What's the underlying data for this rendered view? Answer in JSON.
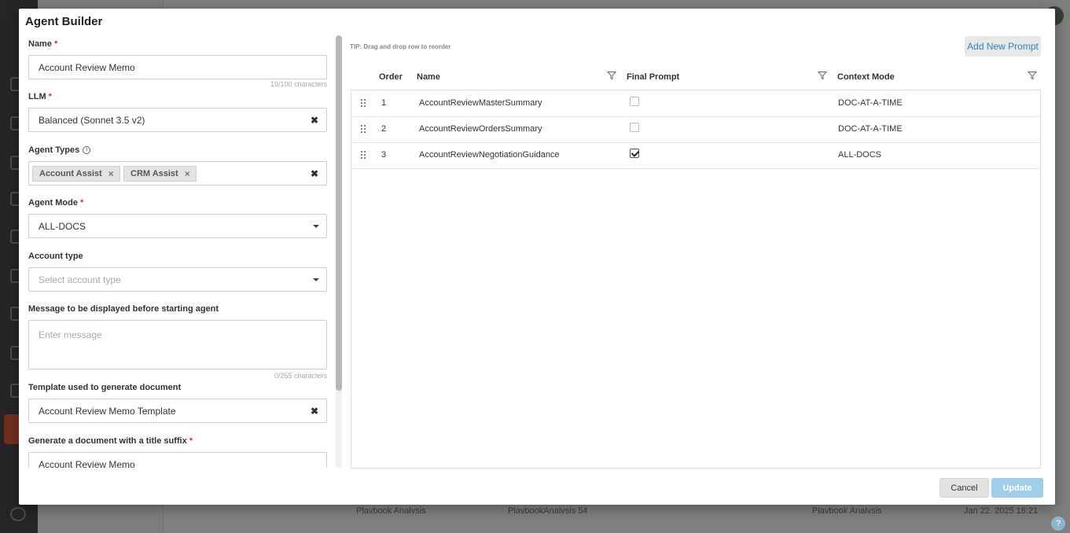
{
  "background": {
    "row": {
      "col1": "Plavbook Analvsis",
      "col2": "PlavbookAnalvsis 54",
      "col3": "Plavbook Analvsis",
      "col4": "Jan 22. 2025 16:21"
    },
    "help": "?"
  },
  "modal": {
    "title": "Agent Builder",
    "form": {
      "name": {
        "label": "Name",
        "value": "Account Review Memo",
        "counter": "19/100 characters"
      },
      "llm": {
        "label": "LLM",
        "value": "Balanced (Sonnet 3.5 v2)"
      },
      "agent_types": {
        "label": "Agent Types",
        "tags": [
          "Account Assist",
          "CRM Assist"
        ]
      },
      "agent_mode": {
        "label": "Agent Mode",
        "value": "ALL-DOCS"
      },
      "account_type": {
        "label": "Account type",
        "placeholder": "Select account type"
      },
      "message": {
        "label": "Message to be displayed before starting agent",
        "placeholder": "Enter message",
        "counter": "0/255 characters"
      },
      "template": {
        "label": "Template used to generate document",
        "value": "Account Review Memo Template"
      },
      "title_suffix": {
        "label": "Generate a document with a title suffix",
        "value": "Account Review Memo"
      }
    },
    "prompts": {
      "tip": "TIP: Drag and drop row to reorder",
      "add_label": "Add New Prompt",
      "columns": {
        "order": "Order",
        "name": "Name",
        "final": "Final Prompt",
        "context": "Context Mode"
      },
      "rows": [
        {
          "order": "1",
          "name": "AccountReviewMasterSummary",
          "final": false,
          "context": "DOC-AT-A-TIME"
        },
        {
          "order": "2",
          "name": "AccountReviewOrdersSummary",
          "final": false,
          "context": "DOC-AT-A-TIME"
        },
        {
          "order": "3",
          "name": "AccountReviewNegotiationGuidance",
          "final": true,
          "context": "ALL-DOCS"
        }
      ]
    },
    "footer": {
      "cancel": "Cancel",
      "update": "Update"
    }
  },
  "colors": {
    "accent": "#2a86c2",
    "update_disabled": "#9fcdea",
    "required": "#d0343a",
    "nav_active": "#e3603f"
  },
  "icons": [
    "info-icon",
    "clear-icon",
    "caret-down-icon",
    "tag-remove-icon",
    "filter-icon",
    "drag-handle-icon",
    "checkbox"
  ]
}
